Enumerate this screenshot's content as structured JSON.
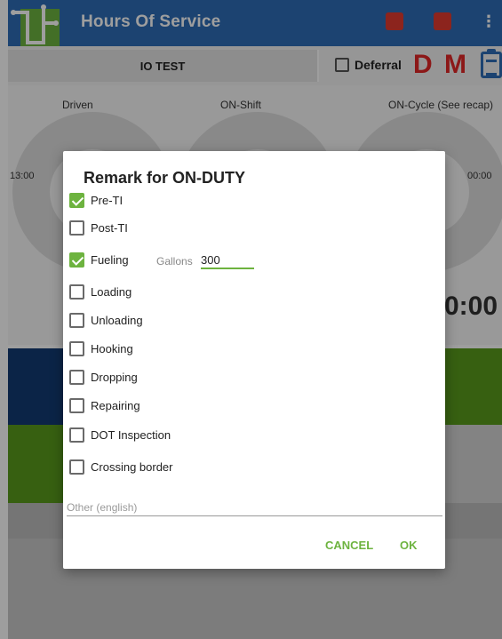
{
  "app": {
    "title": "Hours Of Service",
    "accent": "#2e6db6",
    "icons": [
      "eld-device-icon",
      "truck-icon",
      "overflow-menu-icon",
      "clipboard-icon"
    ]
  },
  "info_row": {
    "driver_label": "IO TEST",
    "deferral_label": "Deferral",
    "deferral_checked": false,
    "d_letter": "D",
    "m_letter": "M"
  },
  "gauges": {
    "driven_label": "Driven",
    "onshift_label": "ON-Shift",
    "oncycle_label": "ON-Cycle (See recap)",
    "left_time": "13:00",
    "right_time": "00:00",
    "big_clock": "0:00"
  },
  "dialog": {
    "title": "Remark for ON-DUTY",
    "options": [
      {
        "label": "Pre-TI",
        "checked": true
      },
      {
        "label": "Post-TI",
        "checked": false
      },
      {
        "label": "Fueling",
        "checked": true
      },
      {
        "label": "Loading",
        "checked": false
      },
      {
        "label": "Unloading",
        "checked": false
      },
      {
        "label": "Hooking",
        "checked": false
      },
      {
        "label": "Dropping",
        "checked": false
      },
      {
        "label": "Repairing",
        "checked": false
      },
      {
        "label": "DOT Inspection",
        "checked": false
      },
      {
        "label": "Crossing border",
        "checked": false
      }
    ],
    "gallons_label": "Gallons",
    "gallons_value": "300",
    "other_placeholder": "Other (english)",
    "cancel_label": "CANCEL",
    "ok_label": "OK",
    "button_color": "#6db33f"
  }
}
